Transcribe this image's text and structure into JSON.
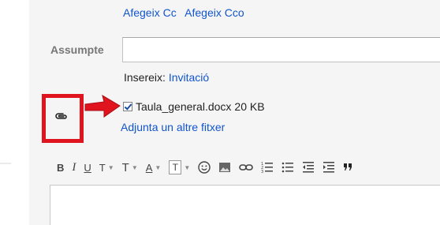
{
  "recipients": {
    "add_cc_label": "Afegeix Cc",
    "add_bcc_label": "Afegeix Cco"
  },
  "subject": {
    "label": "Assumpte",
    "value": ""
  },
  "insert": {
    "label": "Insereix:",
    "invitation_link": "Invitació"
  },
  "attachment": {
    "checked": true,
    "filename": "Taula_general.docx",
    "size": "20 KB",
    "add_another_label": "Adjunta un altre fitxer"
  },
  "toolbar": {
    "bold": "B",
    "italic": "I",
    "underline": "U",
    "font": "T",
    "size": "T",
    "text_color": "A",
    "bg_color": "T"
  },
  "colors": {
    "link": "#1155cc",
    "highlight": "#e0141e",
    "panel_background": "#f5f5f5"
  }
}
